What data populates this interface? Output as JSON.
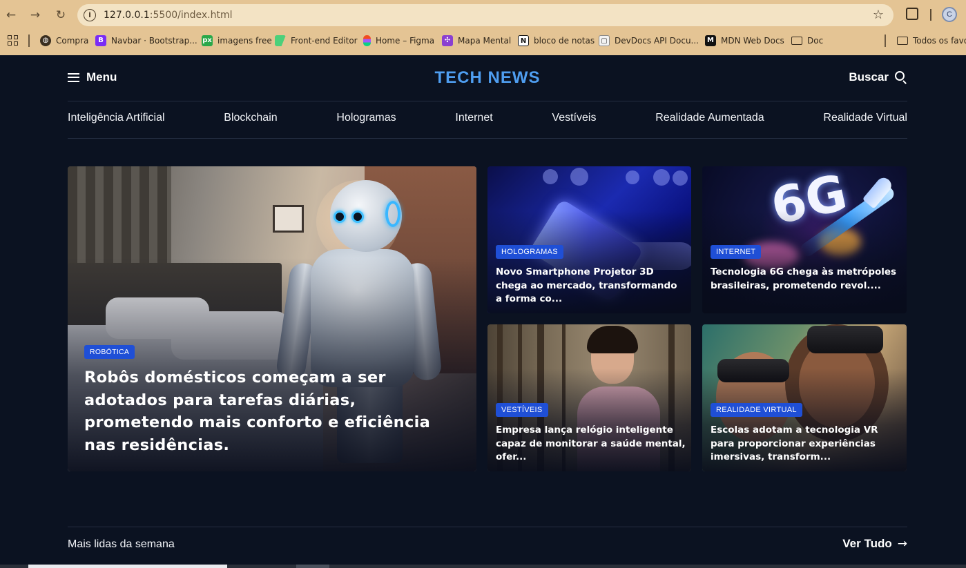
{
  "browser": {
    "url_host": "127.0.0.1",
    "url_path": ":5500/index.html",
    "profile_initial": "C",
    "icons": [
      "back-icon",
      "forward-icon",
      "reload-icon",
      "site-info-icon",
      "bookmark-star-icon",
      "extensions-icon",
      "profile-avatar"
    ],
    "bookmarks": [
      {
        "label": "Compra",
        "icon": "globe-icon"
      },
      {
        "label": "Navbar · Bootstrap...",
        "icon": "bootstrap-icon",
        "color": "#7a2cf5"
      },
      {
        "label": "imagens free",
        "icon": "pixabay-icon",
        "color": "#2aa84a"
      },
      {
        "label": "Front-end Editor",
        "icon": "editor-icon",
        "color": "#4cd07a"
      },
      {
        "label": "Home – Figma",
        "icon": "figma-icon"
      },
      {
        "label": "Mapa Mental",
        "icon": "mindmap-icon",
        "color": "#8a3fd1"
      },
      {
        "label": "bloco de notas",
        "icon": "notion-icon"
      },
      {
        "label": "DevDocs API Docu...",
        "icon": "devdocs-icon"
      },
      {
        "label": "MDN Web Docs",
        "icon": "mdn-icon"
      },
      {
        "label": "Doc",
        "icon": "folder-icon"
      }
    ],
    "other_bookmarks": "Todos os favor"
  },
  "header": {
    "menu_label": "Menu",
    "logo": "TECH NEWS",
    "search_label": "Buscar",
    "logo_color": "#4f9ef1"
  },
  "categories": [
    "Inteligência Artificial",
    "Blockchain",
    "Hologramas",
    "Internet",
    "Vestíveis",
    "Realidade Aumentada",
    "Realidade Virtual"
  ],
  "featured": {
    "tag": "Robótica",
    "title": "Robôs domésticos começam a ser adotados para tarefas diárias, prometendo mais conforto e eficiência nas residências."
  },
  "cards": [
    {
      "tag": "Hologramas",
      "title": "Novo Smartphone Projetor 3D chega ao mercado, transformando a forma co..."
    },
    {
      "tag": "Internet",
      "title": "Tecnologia 6G chega às metrópoles brasileiras, prometendo revol...."
    },
    {
      "tag": "Vestíveis",
      "title": "Empresa lança relógio inteligente capaz de monitorar a saúde mental, ofer..."
    },
    {
      "tag": "Realidade Virtual",
      "title": "Escolas adotam a tecnologia VR para proporcionar experiências imersivas, transform..."
    }
  ],
  "image_6g_text": "6G",
  "badge_color": "#1f4fd6",
  "most_read": {
    "label": "Mais lidas da semana",
    "see_all": "Ver Tudo"
  }
}
